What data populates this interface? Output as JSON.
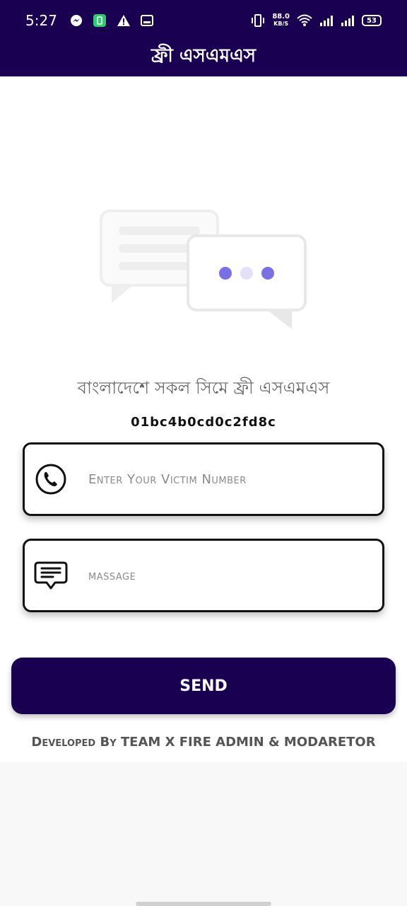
{
  "status_bar": {
    "time": "5:27",
    "speed_value": "88.0",
    "speed_unit": "KB/S",
    "battery": "53"
  },
  "app": {
    "title": "ফ্রী এসএমএস"
  },
  "main": {
    "subtitle": "বাংলাদেশে সকল সিমে ফ্রী এসএমএস",
    "code": "01bc4b0cd0c2fd8c",
    "phone_placeholder": "Enter Your Victim Number",
    "message_placeholder": "massage",
    "send_label": "SEND",
    "footer": "Developed By TEAM X FIRE ADMIN & MODARETOR"
  },
  "colors": {
    "primary": "#1a0050",
    "dot_accent": "#7b6fe6"
  },
  "icons": {
    "phone": "phone-icon",
    "message": "message-icon"
  }
}
